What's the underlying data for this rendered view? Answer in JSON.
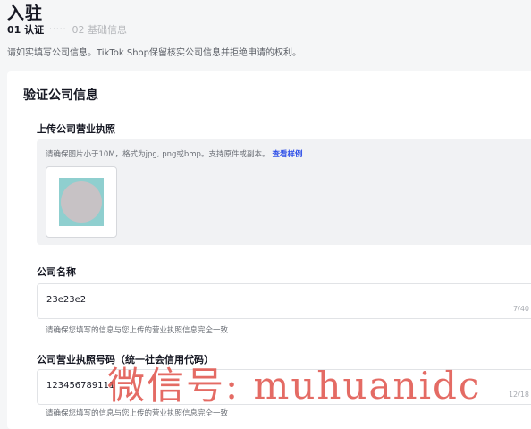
{
  "page": {
    "title": "入驻",
    "steps": [
      {
        "label": "01 认证",
        "active": true
      },
      {
        "label": "02 基础信息",
        "active": false
      }
    ],
    "notice": "请如实填写公司信息。TikTok Shop保留核实公司信息并拒绝申请的权利。"
  },
  "card": {
    "section_title": "验证公司信息",
    "upload": {
      "label": "上传公司营业执照",
      "hint": "请确保图片小于10M，格式为jpg, png或bmp。支持原件或副本。",
      "example_link": "查看样例"
    },
    "company_name": {
      "label": "公司名称",
      "value": "23e23e2",
      "counter": "7/40",
      "helper": "请确保您填写的信息与您上传的营业执照信息完全一致"
    },
    "license_number": {
      "label": "公司营业执照号码（统一社会信用代码）",
      "value": "123456789111",
      "counter": "12/18",
      "helper": "请确保您填写的信息与您上传的营业执照信息完全一致"
    }
  },
  "watermark": "微信号: muhuanidc",
  "colors": {
    "link": "#3050e8",
    "watermark": "#e0524a",
    "background": "#f5f6f7"
  }
}
